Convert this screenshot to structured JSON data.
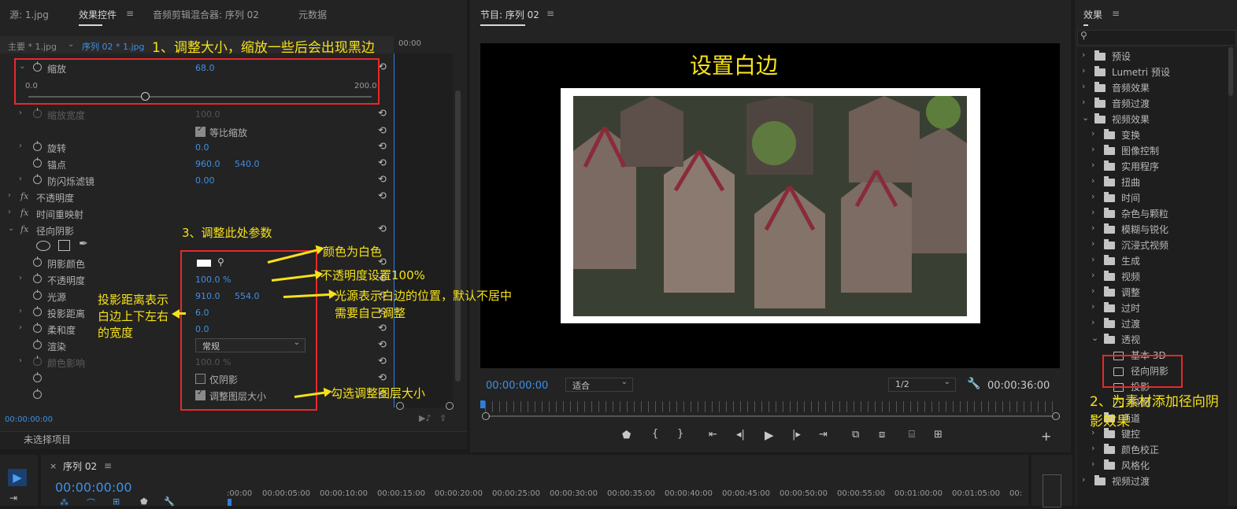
{
  "left_panel": {
    "tabs": [
      "源: 1.jpg",
      "效果控件",
      "音频剪辑混合器: 序列 02",
      "元数据"
    ],
    "active_tab": "效果控件",
    "header": {
      "master": "主要 * 1.jpg",
      "sequence": "序列 02 * 1.jpg",
      "time": "00:00"
    },
    "scale": {
      "label": "缩放",
      "value": "68.0",
      "min": "0.0",
      "max": "200.0",
      "level": 0.34
    },
    "rows": {
      "scale_width": {
        "label": "缩放宽度",
        "value": "100.0"
      },
      "uniform_scale": {
        "label": "等比缩放"
      },
      "rotation": {
        "label": "旋转",
        "value": "0.0"
      },
      "anchor": {
        "label": "锚点",
        "value1": "960.0",
        "value2": "540.0"
      },
      "anti_flicker": {
        "label": "防闪烁滤镜",
        "value": "0.00"
      },
      "opacity_fx": {
        "label": "不透明度"
      },
      "time_remap": {
        "label": "时间重映射"
      },
      "radial_shadow": {
        "label": "径向阴影"
      },
      "shadow_color": {
        "label": "阴影颜色"
      },
      "shadow_opacity": {
        "label": "不透明度",
        "value": "100.0 %"
      },
      "light_source": {
        "label": "光源",
        "value1": "910.0",
        "value2": "554.0"
      },
      "projection_distance": {
        "label": "投影距离",
        "value": "6.0"
      },
      "softness": {
        "label": "柔和度",
        "value": "0.0"
      },
      "render": {
        "label": "渲染",
        "value": "常规"
      },
      "color_influence": {
        "label": "颜色影响",
        "value": "100.0 %"
      },
      "shadow_only": {
        "label": "仅阴影"
      },
      "resize_layer": {
        "label": "调整图层大小"
      }
    },
    "footer_time": "00:00:00:00",
    "no_selection": "未选择项目"
  },
  "program": {
    "title": "节目: 序列 02",
    "video_text": "设置白边",
    "timecode": "00:00:00:00",
    "fit": "适合",
    "resolution": "1/2",
    "duration": "00:00:36:00"
  },
  "effects_panel": {
    "title": "效果",
    "items": [
      {
        "label": "预设",
        "level": 0,
        "type": "folder"
      },
      {
        "label": "Lumetri 预设",
        "level": 0,
        "type": "folder"
      },
      {
        "label": "音频效果",
        "level": 0,
        "type": "folder"
      },
      {
        "label": "音频过渡",
        "level": 0,
        "type": "folder"
      },
      {
        "label": "视频效果",
        "level": 0,
        "type": "folder-open"
      },
      {
        "label": "变换",
        "level": 1,
        "type": "folder"
      },
      {
        "label": "图像控制",
        "level": 1,
        "type": "folder"
      },
      {
        "label": "实用程序",
        "level": 1,
        "type": "folder"
      },
      {
        "label": "扭曲",
        "level": 1,
        "type": "folder"
      },
      {
        "label": "时间",
        "level": 1,
        "type": "folder"
      },
      {
        "label": "杂色与颗粒",
        "level": 1,
        "type": "folder"
      },
      {
        "label": "模糊与锐化",
        "level": 1,
        "type": "folder"
      },
      {
        "label": "沉浸式视频",
        "level": 1,
        "type": "folder"
      },
      {
        "label": "生成",
        "level": 1,
        "type": "folder"
      },
      {
        "label": "视频",
        "level": 1,
        "type": "folder"
      },
      {
        "label": "调整",
        "level": 1,
        "type": "folder"
      },
      {
        "label": "过时",
        "level": 1,
        "type": "folder"
      },
      {
        "label": "过渡",
        "level": 1,
        "type": "folder"
      },
      {
        "label": "透视",
        "level": 1,
        "type": "folder-open"
      },
      {
        "label": "基本 3D",
        "level": 2,
        "type": "effect"
      },
      {
        "label": "径向阴影",
        "level": 2,
        "type": "effect"
      },
      {
        "label": "投影",
        "level": 2,
        "type": "effect"
      },
      {
        "label": "斜面",
        "level": 2,
        "type": "effect"
      },
      {
        "label": "通道",
        "level": 1,
        "type": "folder"
      },
      {
        "label": "键控",
        "level": 1,
        "type": "folder"
      },
      {
        "label": "颜色校正",
        "level": 1,
        "type": "folder"
      },
      {
        "label": "风格化",
        "level": 1,
        "type": "folder"
      },
      {
        "label": "视频过渡",
        "level": 0,
        "type": "folder"
      }
    ]
  },
  "timeline": {
    "tab": "序列 02",
    "timecode": "00:00:00:00",
    "ruler": [
      ":00:00",
      "00:00:05:00",
      "00:00:10:00",
      "00:00:15:00",
      "00:00:20:00",
      "00:00:25:00",
      "00:00:30:00",
      "00:00:35:00",
      "00:00:40:00",
      "00:00:45:00",
      "00:00:50:00",
      "00:00:55:00",
      "00:01:00:00",
      "00:01:05:00",
      "00:"
    ]
  },
  "annotations": {
    "a1": "1、调整大小，缩放一些后会出现黑边",
    "a2": "2、为素材添加径向阴影效果",
    "a3": "3、调整此处参数",
    "color": "颜色为白色",
    "opacity": "不透明度设置100%",
    "light": "光源表示白边的位置，默认不居中",
    "light2": "需要自己调整",
    "distance": "投影距离表示白边上下左右的宽度",
    "resize": "勾选调整图层大小"
  }
}
